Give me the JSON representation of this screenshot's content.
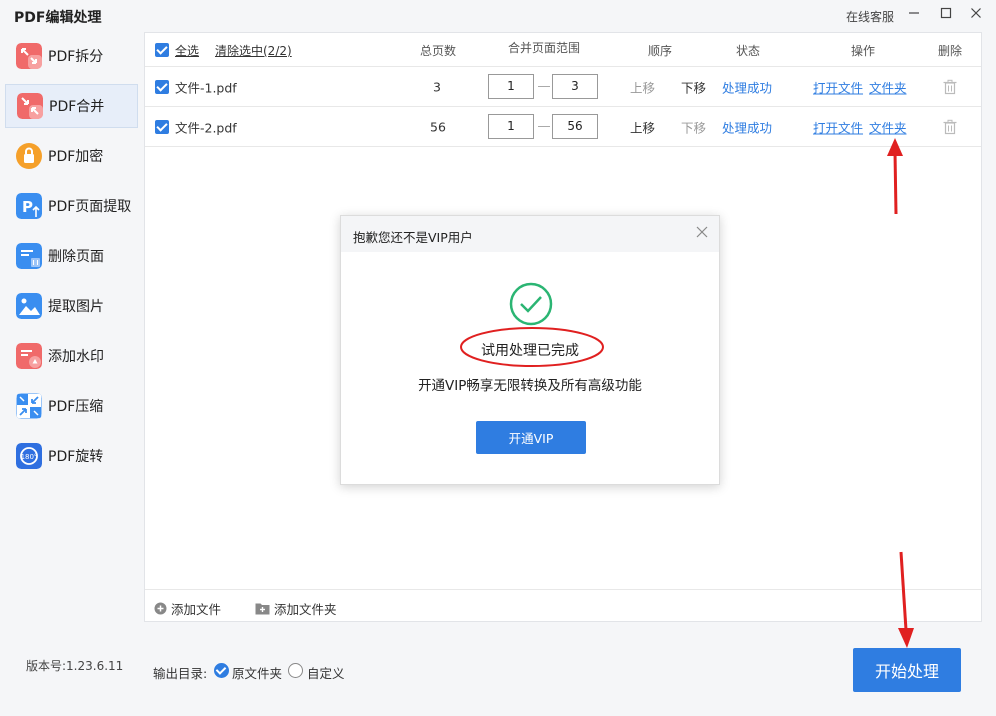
{
  "app": {
    "title": "PDF编辑处理",
    "support": "在线客服"
  },
  "sidebar": {
    "items": [
      {
        "label": "PDF拆分",
        "color": "#f06a6a"
      },
      {
        "label": "PDF合并",
        "color": "#f06a6a"
      },
      {
        "label": "PDF加密",
        "color": "#f5a02a"
      },
      {
        "label": "PDF页面提取",
        "color": "#3a8ef0"
      },
      {
        "label": "删除页面",
        "color": "#3a8ef0"
      },
      {
        "label": "提取图片",
        "color": "#3a8ef0"
      },
      {
        "label": "添加水印",
        "color": "#f06a6a"
      },
      {
        "label": "PDF压缩",
        "color": "#3a8ef0"
      },
      {
        "label": "PDF旋转",
        "color": "#2f6fe0"
      }
    ],
    "active_index": 1
  },
  "version": "版本号:1.23.6.11",
  "table": {
    "select_all": "全选",
    "clear_selection": "清除选中(2/2)",
    "columns": {
      "pages": "总页数",
      "range": "合并页面范围",
      "order": "顺序",
      "status": "状态",
      "action": "操作",
      "delete": "删除"
    },
    "rows": [
      {
        "name": "文件-1.pdf",
        "pages": "3",
        "from": "1",
        "to": "3",
        "up": "上移",
        "down": "下移",
        "status": "处理成功",
        "open": "打开文件",
        "folder": "文件夹"
      },
      {
        "name": "文件-2.pdf",
        "pages": "56",
        "from": "1",
        "to": "56",
        "up": "上移",
        "down": "下移",
        "status": "处理成功",
        "open": "打开文件",
        "folder": "文件夹"
      }
    ]
  },
  "footer": {
    "add_file": "添加文件",
    "add_folder": "添加文件夹"
  },
  "output": {
    "label": "输出目录:",
    "original": "原文件夹",
    "custom": "自定义"
  },
  "start_button": "开始处理",
  "dialog": {
    "title": "抱歉您还不是VIP用户",
    "message": "试用处理已完成",
    "sub": "开通VIP畅享无限转换及所有高级功能",
    "button": "开通VIP"
  },
  "colors": {
    "accent": "#2f7de1",
    "success": "#2bb573",
    "annotation": "#e02020"
  }
}
